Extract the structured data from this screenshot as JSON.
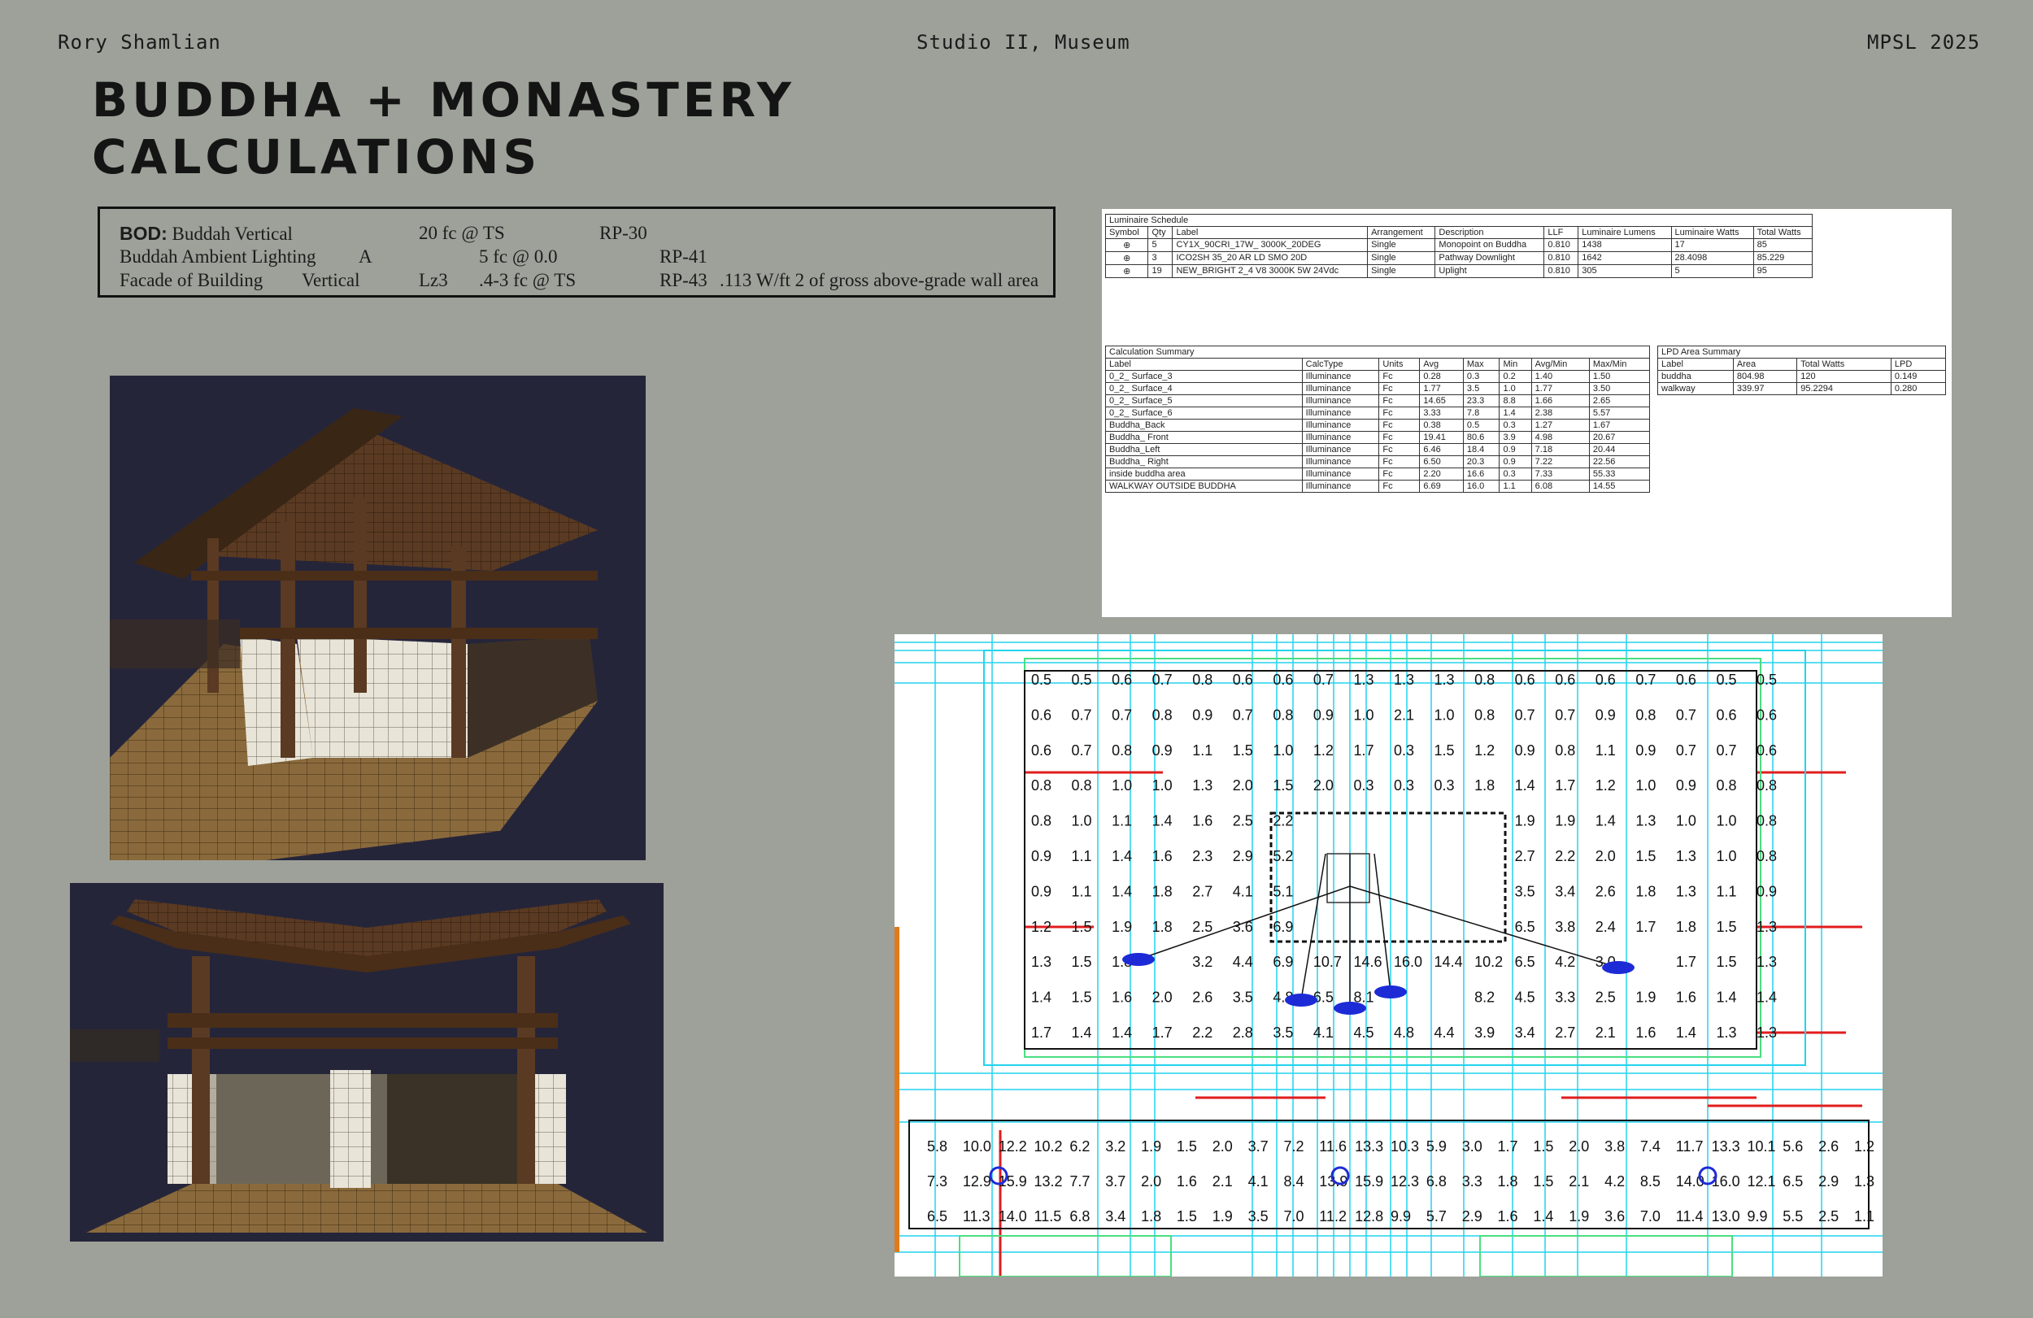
{
  "header": {
    "author": "Rory Shamlian",
    "course": "Studio II, Museum",
    "program": "MPSL 2025"
  },
  "title": {
    "line1": "BUDDHA + MONASTERY",
    "line2": "CALCULATIONS"
  },
  "bod": {
    "prefix": "BOD:",
    "rows": [
      {
        "label": "Buddah Vertical",
        "zone": "",
        "target": "20 fc @ TS",
        "ref": "RP-30",
        "note": ""
      },
      {
        "label": "Buddah Ambient Lighting",
        "zone": "A",
        "target": "5 fc @ 0.0",
        "ref": "RP-41",
        "note": ""
      },
      {
        "label": "Facade of Building",
        "zone": "Vertical",
        "zone2": "Lz3",
        "target": ".4-3 fc @ TS",
        "ref": "RP-43",
        "note": ".113 W/ft 2 of gross above-grade wall area"
      }
    ]
  },
  "luminaire_schedule": {
    "title": "Luminaire Schedule",
    "headers": [
      "Symbol",
      "Qty",
      "Label",
      "Arrangement",
      "Description",
      "LLF",
      "Luminaire Lumens",
      "Luminaire Watts",
      "Total Watts"
    ],
    "rows": [
      [
        "",
        "5",
        "CY1X_90CRI_17W_ 3000K_20DEG",
        "Single",
        "Monopoint on Buddha",
        "0.810",
        "1438",
        "17",
        "85"
      ],
      [
        "",
        "3",
        "ICO2SH 35_20 AR LD SMO 20D",
        "Single",
        "Pathway Downlight",
        "0.810",
        "1642",
        "28.4098",
        "85.229"
      ],
      [
        "",
        "19",
        "NEW_BRIGHT 2_4 V8 3000K 5W 24Vdc",
        "Single",
        "Uplight",
        "0.810",
        "305",
        "5",
        "95"
      ]
    ]
  },
  "calculation_summary": {
    "title": "Calculation Summary",
    "headers": [
      "Label",
      "CalcType",
      "Units",
      "Avg",
      "Max",
      "Min",
      "Avg/Min",
      "Max/Min"
    ],
    "rows": [
      [
        "0_2_ Surface_3",
        "Illuminance",
        "Fc",
        "0.28",
        "0.3",
        "0.2",
        "1.40",
        "1.50"
      ],
      [
        "0_2_ Surface_4",
        "Illuminance",
        "Fc",
        "1.77",
        "3.5",
        "1.0",
        "1.77",
        "3.50"
      ],
      [
        "0_2_ Surface_5",
        "Illuminance",
        "Fc",
        "14.65",
        "23.3",
        "8.8",
        "1.66",
        "2.65"
      ],
      [
        "0_2_ Surface_6",
        "Illuminance",
        "Fc",
        "3.33",
        "7.8",
        "1.4",
        "2.38",
        "5.57"
      ],
      [
        "Buddha_Back",
        "Illuminance",
        "Fc",
        "0.38",
        "0.5",
        "0.3",
        "1.27",
        "1.67"
      ],
      [
        "Buddha_ Front",
        "Illuminance",
        "Fc",
        "19.41",
        "80.6",
        "3.9",
        "4.98",
        "20.67"
      ],
      [
        "Buddha_Left",
        "Illuminance",
        "Fc",
        "6.46",
        "18.4",
        "0.9",
        "7.18",
        "20.44"
      ],
      [
        "Buddha_ Right",
        "Illuminance",
        "Fc",
        "6.50",
        "20.3",
        "0.9",
        "7.22",
        "22.56"
      ],
      [
        "inside buddha area",
        "Illuminance",
        "Fc",
        "2.20",
        "16.6",
        "0.3",
        "7.33",
        "55.33"
      ],
      [
        "WALKWAY OUTSIDE BUDDHA",
        "Illuminance",
        "Fc",
        "6.69",
        "16.0",
        "1.1",
        "6.08",
        "14.55"
      ]
    ]
  },
  "lpd_summary": {
    "title": "LPD Area Summary",
    "headers": [
      "Label",
      "Area",
      "Total Watts",
      "LPD"
    ],
    "rows": [
      [
        "buddha",
        "804.98",
        "120",
        "0.149"
      ],
      [
        "walkway",
        "339.97",
        "95.2294",
        "0.280"
      ]
    ]
  },
  "plan_grid": {
    "upper_rows": [
      [
        "0.5",
        "0.5",
        "0.6",
        "0.7",
        "0.8",
        "0.6",
        "0.6",
        "0.7",
        "1.3",
        "1.3",
        "1.3",
        "0.8",
        "0.6",
        "0.6",
        "0.6",
        "0.7",
        "0.6",
        "0.5",
        "0.5"
      ],
      [
        "0.6",
        "0.7",
        "0.7",
        "0.8",
        "0.9",
        "0.7",
        "0.8",
        "0.9",
        "1.0",
        "2.1",
        "1.0",
        "0.8",
        "0.7",
        "0.7",
        "0.9",
        "0.8",
        "0.7",
        "0.6",
        "0.6"
      ],
      [
        "0.6",
        "0.7",
        "0.8",
        "0.9",
        "1.1",
        "1.5",
        "1.0",
        "1.2",
        "1.7",
        "0.3",
        "1.5",
        "1.2",
        "0.9",
        "0.8",
        "1.1",
        "0.9",
        "0.7",
        "0.7",
        "0.6"
      ],
      [
        "0.8",
        "0.8",
        "1.0",
        "1.0",
        "1.3",
        "2.0",
        "1.5",
        "2.0",
        "0.3",
        "0.3",
        "0.3",
        "1.8",
        "1.4",
        "1.7",
        "1.2",
        "1.0",
        "0.9",
        "0.8",
        "0.8"
      ],
      [
        "0.8",
        "1.0",
        "1.1",
        "1.4",
        "1.6",
        "2.5",
        "2.2",
        "",
        "",
        "",
        "",
        "",
        "1.9",
        "1.9",
        "1.4",
        "1.3",
        "1.0",
        "1.0",
        "0.8"
      ],
      [
        "0.9",
        "1.1",
        "1.4",
        "1.6",
        "2.3",
        "2.9",
        "5.2",
        "",
        "",
        "",
        "",
        "",
        "2.7",
        "2.2",
        "2.0",
        "1.5",
        "1.3",
        "1.0",
        "0.8"
      ],
      [
        "0.9",
        "1.1",
        "1.4",
        "1.8",
        "2.7",
        "4.1",
        "5.1",
        "",
        "",
        "",
        "",
        "",
        "3.5",
        "3.4",
        "2.6",
        "1.8",
        "1.3",
        "1.1",
        "0.9"
      ],
      [
        "1.2",
        "1.5",
        "1.9",
        "1.8",
        "2.5",
        "3.6",
        "6.9",
        "",
        "",
        "",
        "",
        "",
        "6.5",
        "3.8",
        "2.4",
        "1.7",
        "1.8",
        "1.5",
        "1.3"
      ],
      [
        "1.3",
        "1.5",
        "1.8",
        "",
        "3.2",
        "4.4",
        "6.9",
        "10.7",
        "14.6",
        "16.0",
        "14.4",
        "10.2",
        "6.5",
        "4.2",
        "3.0",
        "",
        "1.7",
        "1.5",
        "1.3"
      ],
      [
        "1.4",
        "1.5",
        "1.6",
        "2.0",
        "2.6",
        "3.5",
        "4.8",
        "6.5",
        "8.1",
        "",
        "",
        "8.2",
        "4.5",
        "3.3",
        "2.5",
        "1.9",
        "1.6",
        "1.4",
        "1.4"
      ],
      [
        "1.7",
        "1.4",
        "1.4",
        "1.7",
        "2.2",
        "2.8",
        "3.5",
        "4.1",
        "4.5",
        "4.8",
        "4.4",
        "3.9",
        "3.4",
        "2.7",
        "2.1",
        "1.6",
        "1.4",
        "1.3",
        "1.3"
      ]
    ],
    "lower_rows": [
      [
        "5.8",
        "10.0",
        "12.2",
        "10.2",
        "6.2",
        "3.2",
        "1.9",
        "1.5",
        "2.0",
        "3.7",
        "7.2",
        "11.6",
        "13.3",
        "10.3",
        "5.9",
        "3.0",
        "1.7",
        "1.5",
        "2.0",
        "3.8",
        "7.4",
        "11.7",
        "13.3",
        "10.1",
        "5.6",
        "2.6",
        "1.2"
      ],
      [
        "7.3",
        "12.9",
        "15.9",
        "13.2",
        "7.7",
        "3.7",
        "2.0",
        "1.6",
        "2.1",
        "4.1",
        "8.4",
        "13.9",
        "15.9",
        "12.3",
        "6.8",
        "3.3",
        "1.8",
        "1.5",
        "2.1",
        "4.2",
        "8.5",
        "14.0",
        "16.0",
        "12.1",
        "6.5",
        "2.9",
        "1.3"
      ],
      [
        "6.5",
        "11.3",
        "14.0",
        "11.5",
        "6.8",
        "3.4",
        "1.8",
        "1.5",
        "1.9",
        "3.5",
        "7.0",
        "11.2",
        "12.8",
        "9.9",
        "5.7",
        "2.9",
        "1.6",
        "1.4",
        "1.9",
        "3.6",
        "7.0",
        "11.4",
        "13.0",
        "9.9",
        "5.5",
        "2.5",
        "1.1"
      ]
    ]
  },
  "colors": {
    "background": "#9da199",
    "render_bg": "#25253a",
    "grid_cyan": "#22d3ee",
    "grid_green": "#4ade80",
    "grid_red": "#e11d1d",
    "fixture_blue": "#1d2bd6"
  }
}
